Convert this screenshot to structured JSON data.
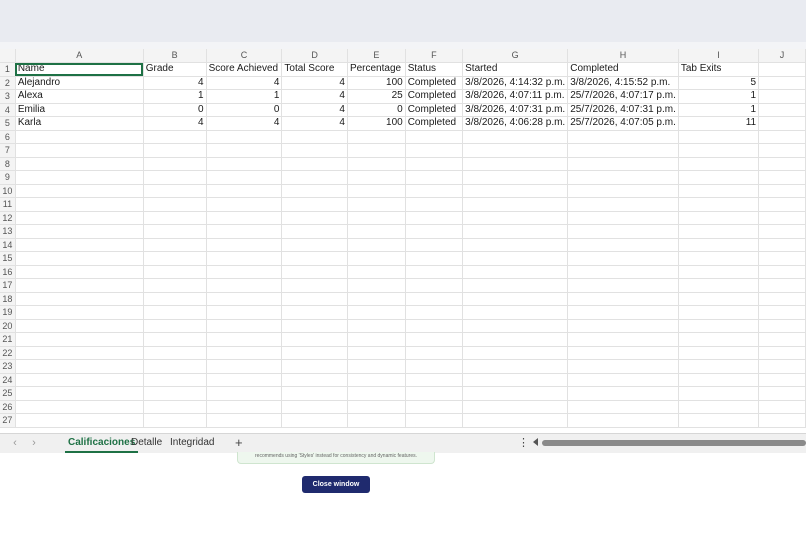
{
  "columns": [
    "A",
    "B",
    "C",
    "D",
    "E",
    "F",
    "G",
    "H",
    "I",
    "J"
  ],
  "header_row": [
    "Name",
    "Grade",
    "Score Achieved",
    "Total Score",
    "Percentage",
    "Status",
    "Started",
    "Completed",
    "Tab Exits",
    ""
  ],
  "rows": [
    [
      "Alejandro",
      "4",
      "4",
      "4",
      "100",
      "Completed",
      "3/8/2026, 4:14:32 p.m.",
      "3/8/2026, 4:15:52 p.m.",
      "5",
      ""
    ],
    [
      "Alexa",
      "1",
      "1",
      "4",
      "25",
      "Completed",
      "3/8/2026, 4:07:11 p.m.",
      "25/7/2026, 4:07:17 p.m.",
      "1",
      ""
    ],
    [
      "Emilia",
      "0",
      "0",
      "4",
      "0",
      "Completed",
      "3/8/2026, 4:07:31 p.m.",
      "25/7/2026, 4:07:31 p.m.",
      "1",
      ""
    ],
    [
      "Karla",
      "4",
      "4",
      "4",
      "100",
      "Completed",
      "3/8/2026, 4:06:28 p.m.",
      "25/7/2026, 4:07:05 p.m.",
      "11",
      ""
    ]
  ],
  "row_numbers": [
    "1",
    "2",
    "3",
    "4",
    "5",
    "6",
    "7",
    "8",
    "9",
    "10",
    "11",
    "12",
    "13",
    "14",
    "15",
    "16",
    "17",
    "18",
    "19",
    "20",
    "21",
    "22",
    "23",
    "24",
    "25",
    "26",
    "27"
  ],
  "sheet_tabs": [
    "Calificaciones",
    "Detalle",
    "Integridad"
  ],
  "active_tab": "Calificaciones",
  "add_sheet_label": "+",
  "more_label": "⋮",
  "nav_prev": "‹",
  "nav_next": "›",
  "notice_text": "recommends using 'Styles' instead for consistency and dynamic features.",
  "close_button_label": "Close window",
  "colors": {
    "accent_green": "#1e7145",
    "button_navy": "#1f2a6e"
  }
}
